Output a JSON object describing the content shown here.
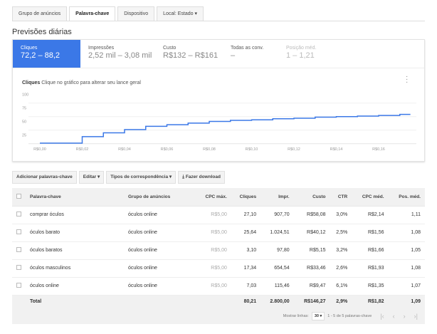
{
  "tabs": [
    "Grupo de anúncios",
    "Palavra-chave",
    "Dispositivo",
    "Local: Estado ▾"
  ],
  "title": "Previsões diárias",
  "metrics": [
    {
      "label": "Cliques",
      "value": "72,2 – 88,2"
    },
    {
      "label": "Impressões",
      "value": "2,52 mil – 3,08 mil"
    },
    {
      "label": "Custo",
      "value": "R$132 – R$161"
    },
    {
      "label": "Todas as conv.",
      "value": "–"
    },
    {
      "label": "Posição méd.",
      "value": "1 – 1,21"
    }
  ],
  "chart_title": {
    "bold": "Cliques",
    "text": "Clique no gráfico para alterar seu lance geral"
  },
  "chart_data": {
    "type": "line",
    "step": true,
    "color": "#3b78e7",
    "xlabel": "",
    "ylabel": "",
    "yticks": [
      "100",
      "75",
      "50",
      "25"
    ],
    "ylim": [
      0,
      100
    ],
    "xticks": [
      "R$0,00",
      "R$0,02",
      "R$0,04",
      "R$0,06",
      "R$0,08",
      "R$0,10",
      "R$0,12",
      "R$0,14",
      "R$0,16"
    ],
    "x": [
      0,
      0.02,
      0.03,
      0.04,
      0.05,
      0.06,
      0.07,
      0.08,
      0.09,
      0.1,
      0.11,
      0.12,
      0.13,
      0.14,
      0.15,
      0.16,
      0.17,
      0.175
    ],
    "y": [
      1,
      13,
      20,
      26,
      32,
      35,
      38,
      41,
      43,
      44,
      46,
      47,
      49,
      50,
      51,
      52,
      54,
      54
    ]
  },
  "buttons": [
    "Adicionar palavras-chave",
    "Editar ▾",
    "Tipos de correspondência ▾",
    "Fazer download"
  ],
  "table": {
    "headers": [
      "Palavra-chave",
      "Grupo de anúncios",
      "CPC máx.",
      "Cliques",
      "Impr.",
      "Custo",
      "CTR",
      "CPC méd.",
      "Pos. méd."
    ],
    "rows": [
      [
        "comprar óculos",
        "óculos online",
        "R$5,00",
        "27,10",
        "907,70",
        "R$58,08",
        "3,0%",
        "R$2,14",
        "1,11"
      ],
      [
        "óculos barato",
        "óculos online",
        "R$5,00",
        "25,64",
        "1.024,51",
        "R$40,12",
        "2,5%",
        "R$1,56",
        "1,08"
      ],
      [
        "óculos baratos",
        "óculos online",
        "R$5,00",
        "3,10",
        "97,80",
        "R$5,15",
        "3,2%",
        "R$1,66",
        "1,05"
      ],
      [
        "óculos masculinos",
        "óculos online",
        "R$5,00",
        "17,34",
        "654,54",
        "R$33,46",
        "2,6%",
        "R$1,93",
        "1,08"
      ],
      [
        "óculos online",
        "óculos online",
        "R$5,00",
        "7,03",
        "115,46",
        "R$9,47",
        "6,1%",
        "R$1,35",
        "1,07"
      ]
    ],
    "total": [
      "Total",
      "80,21",
      "2.800,00",
      "R$146,27",
      "2,9%",
      "R$1,82",
      "1,09"
    ]
  },
  "footer": {
    "show_rows": "Mostrar linhas:",
    "rows_value": "30 ▾",
    "range": "1 - 5 de 5 palavras-chave"
  }
}
